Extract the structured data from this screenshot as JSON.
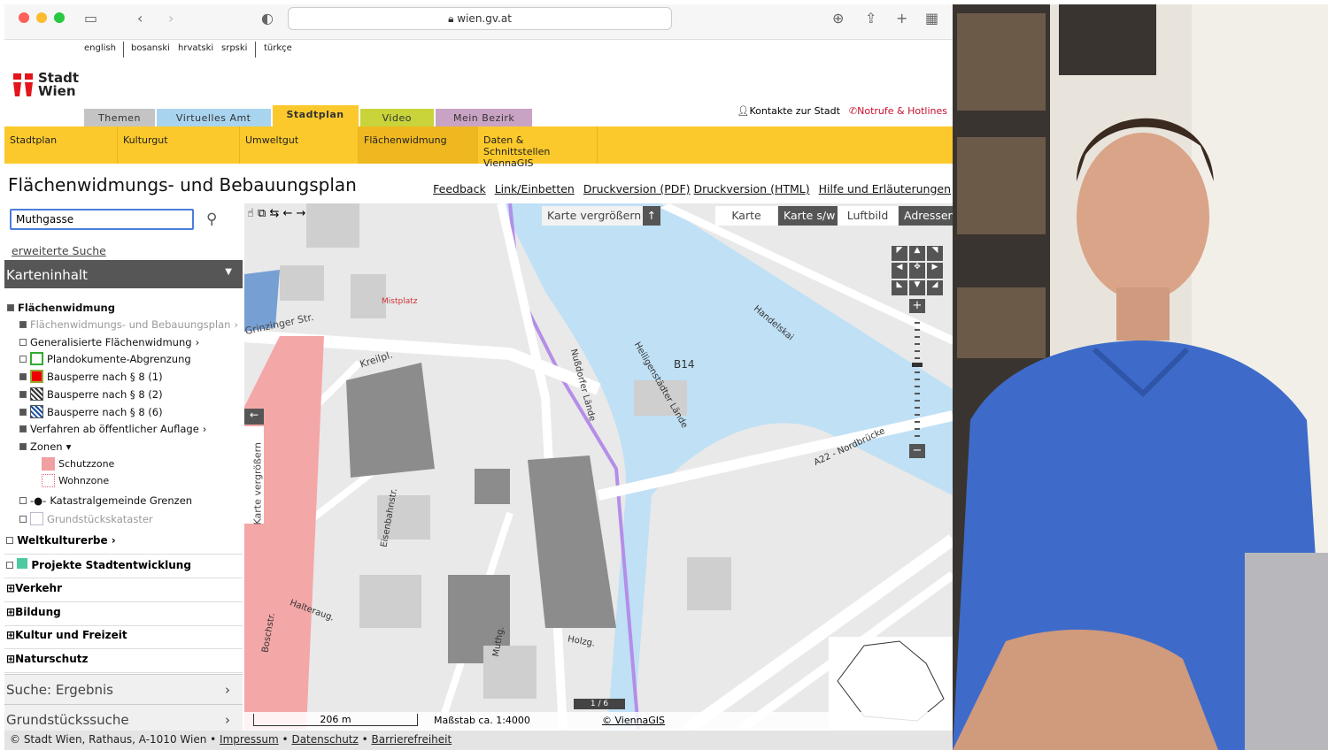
{
  "browser": {
    "url": "wien.gv.at"
  },
  "languages": [
    "english",
    "bosanski",
    "hrvatski",
    "srpski",
    "türkçe"
  ],
  "logo": {
    "line1": "Stadt",
    "line2": "Wien"
  },
  "main_tabs": [
    {
      "label": "Themen",
      "color": "#c4c4c4"
    },
    {
      "label": "Virtuelles Amt",
      "color": "#a9d4ef"
    },
    {
      "label": "Stadtplan",
      "color": "#fcc92c",
      "active": true
    },
    {
      "label": "Video",
      "color": "#c8d43a"
    },
    {
      "label": "Mein Bezirk",
      "color": "#c9a3c4"
    }
  ],
  "header_links": {
    "contacts": "Kontakte zur Stadt",
    "emergency": "Notrufe & Hotlines"
  },
  "sub_tabs": [
    "Stadtplan",
    "Kulturgut",
    "Umweltgut",
    "Flächenwidmung",
    "Daten & Schnittstellen ViennaGIS"
  ],
  "page": {
    "title": "Flächenwidmungs- und Bebauungsplan",
    "links": [
      "Feedback",
      "Link/Einbetten",
      "Druckversion (PDF)",
      "Druckversion (HTML)",
      "Hilfe und Erläuterungen"
    ]
  },
  "sidebar": {
    "search_value": "Muthgasse",
    "advanced_search": "erweiterte Suche",
    "content_header": "Karteninhalt",
    "section": "Flächenwidmung",
    "layers": [
      "Flächenwidmungs- und Bebauungsplan",
      "Generalisierte Flächenwidmung",
      "Plandokumente-Abgrenzung",
      "Bausperre nach § 8 (1)",
      "Bausperre nach § 8 (2)",
      "Bausperre nach § 8 (6)",
      "Verfahren ab öffentlicher Auflage",
      "Zonen",
      "Schutzzone",
      "Wohnzone",
      "Katastralgemeinde Grenzen",
      "Grundstückskataster"
    ],
    "groups": [
      "Weltkulturerbe",
      "Projekte Stadtentwicklung",
      "Verkehr",
      "Bildung",
      "Kultur und Freizeit",
      "Naturschutz"
    ],
    "accordions": [
      "Suche: Ergebnis",
      "Grundstückssuche"
    ]
  },
  "map": {
    "enlarge": "Karte vergrößern",
    "layers": [
      "Karte",
      "Karte s/w",
      "Luftbild",
      "Adressen"
    ],
    "active_layer": "Karte s/w",
    "side_enlarge": "Karte vergrößern",
    "labels": [
      "Grinzinger Str.",
      "Kreilpl.",
      "Mistplatz",
      "B14",
      "Nußdorfer Lände",
      "Handelskai",
      "A22 - Nordbrücke",
      "Heiligenstädter Lände",
      "Halteraug.",
      "Boschstr.",
      "Muthg.",
      "Holzg.",
      "Eisenbahnstr."
    ],
    "scale_distance": "206 m",
    "scale": "Maßstab ca. 1:4000",
    "copyright": "© ViennaGIS",
    "page_indicator": "1 / 6"
  },
  "footer": {
    "text": "© Stadt Wien, Rathaus, A-1010 Wien",
    "links": [
      "Impressum",
      "Datenschutz",
      "Barrierefreiheit"
    ]
  }
}
